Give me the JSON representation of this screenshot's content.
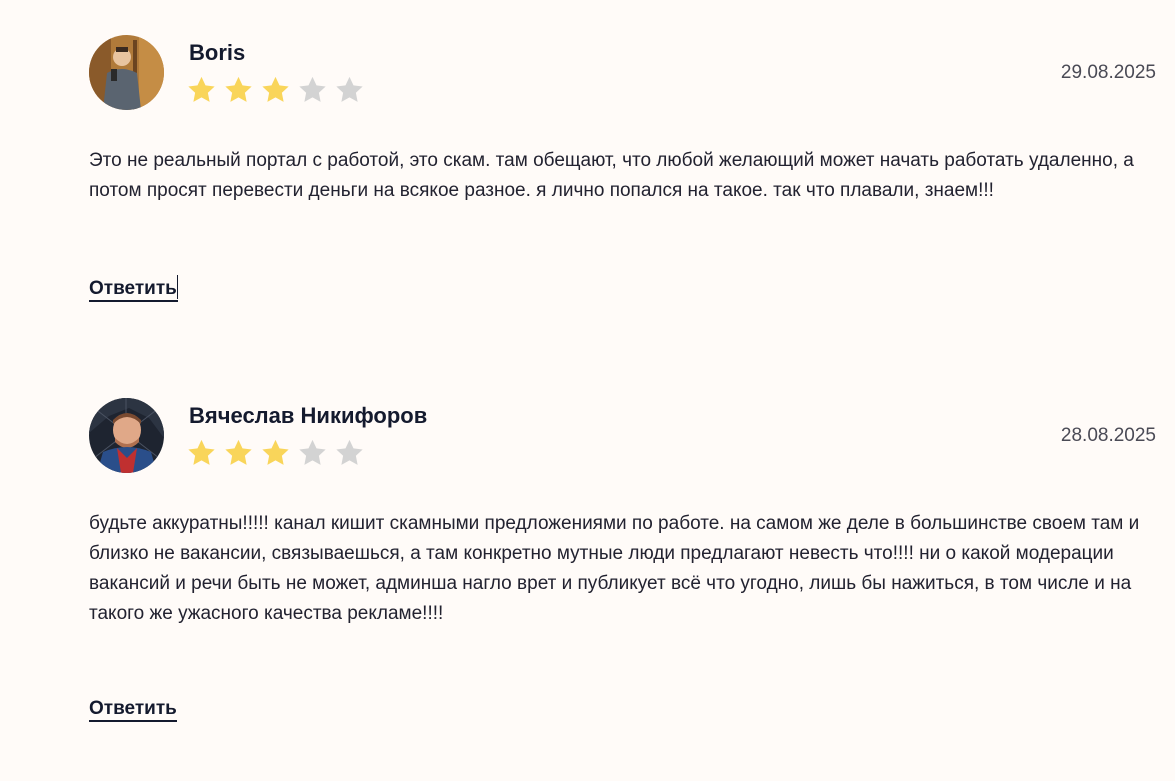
{
  "reviews": [
    {
      "author": "Boris",
      "date": "29.08.2025",
      "rating": 3,
      "max_rating": 5,
      "text": "Это не реальный портал с работой, это скам. там обещают, что любой желающий может начать работать удаленно, а потом просят перевести деньги на всякое разное. я лично попался на такое. так что плавали, знаем!!!",
      "reply_label": "Ответить"
    },
    {
      "author": "Вячеслав Никифоров",
      "date": "28.08.2025",
      "rating": 3,
      "max_rating": 5,
      "text": "будьте аккуратны!!!!! канал кишит скамными предложениями по работе. на самом же деле в большинстве своем там и близко не вакансии, связываешься, а там конкретно мутные люди предлагают невесть что!!!! ни о какой модерации вакансий и речи быть не может, админша нагло врет и публикует всё что угодно, лишь бы нажиться, в том числе и на такого же ужасного качества рекламе!!!!",
      "reply_label": "Ответить"
    }
  ],
  "colors": {
    "background": "#fffbf8",
    "star_filled": "#f9d55a",
    "star_empty": "#d3d3d3",
    "text": "#141a2e"
  },
  "icons": {
    "star": "star-icon"
  }
}
